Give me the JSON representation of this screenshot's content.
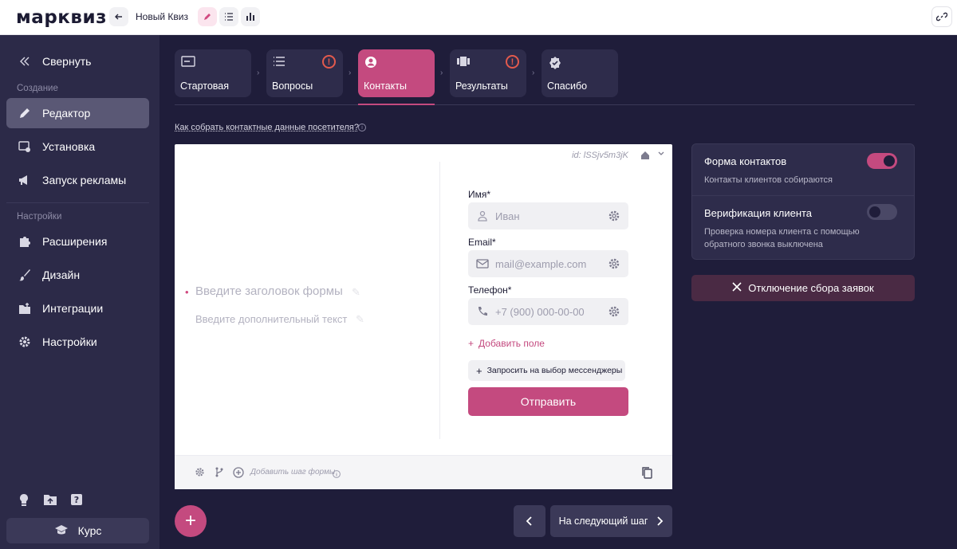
{
  "topbar": {
    "logo": "марквиз",
    "quiz_name": "Новый Квиз"
  },
  "sidebar": {
    "collapse_label": "Свернуть",
    "section_create": "Создание",
    "section_settings": "Настройки",
    "items": [
      {
        "label": "Редактор",
        "icon": "pencil-icon",
        "active": true
      },
      {
        "label": "Установка",
        "icon": "install-icon"
      },
      {
        "label": "Запуск рекламы",
        "icon": "megaphone-icon"
      },
      {
        "label": "Расширения",
        "icon": "puzzle-icon"
      },
      {
        "label": "Дизайн",
        "icon": "brush-icon"
      },
      {
        "label": "Интеграции",
        "icon": "integrations-icon"
      },
      {
        "label": "Настройки",
        "icon": "gear-icon"
      }
    ],
    "course_label": "Курс"
  },
  "steps": [
    {
      "label": "Стартовая",
      "icon": "start-icon",
      "warning": false
    },
    {
      "label": "Вопросы",
      "icon": "list-icon",
      "warning": true
    },
    {
      "label": "Контакты",
      "icon": "user-icon",
      "warning": false,
      "active": true
    },
    {
      "label": "Результаты",
      "icon": "results-icon",
      "warning": true
    },
    {
      "label": "Спасибо",
      "icon": "check-badge-icon",
      "warning": false
    }
  ],
  "howto_link": "Как собрать контактные данные посетителя?",
  "card": {
    "id_text": "id: lSSjv5m3jK",
    "form_title_placeholder": "Введите заголовок формы",
    "form_sub_placeholder": "Введите дополнительный текст",
    "fields": [
      {
        "label": "Имя*",
        "placeholder": "Иван",
        "icon": "person-icon"
      },
      {
        "label": "Email*",
        "placeholder": "mail@example.com",
        "icon": "mail-icon"
      },
      {
        "label": "Телефон*",
        "placeholder": "+7 (900) 000-00-00",
        "icon": "phone-icon"
      }
    ],
    "add_field": "Добавить поле",
    "messenger_btn": "Запросить на выбор мессенджеры",
    "submit": "Отправить",
    "footer_add_step": "Добавить шаг формы"
  },
  "right_panel": {
    "contact_form_title": "Форма контактов",
    "contact_form_sub": "Контакты клиентов собираются",
    "contact_form_on": true,
    "verification_title": "Верификация клиента",
    "verification_sub": "Проверка номера клиента с помощью обратного звонка выключена",
    "verification_on": false,
    "disable_btn": "Отключение сбора заявок"
  },
  "bottom": {
    "next_label": "На следующий шаг"
  },
  "colors": {
    "accent": "#c44a7f",
    "bg": "#1f1d3a",
    "sidebar": "#2c2a48",
    "warning": "#e25a4d"
  }
}
